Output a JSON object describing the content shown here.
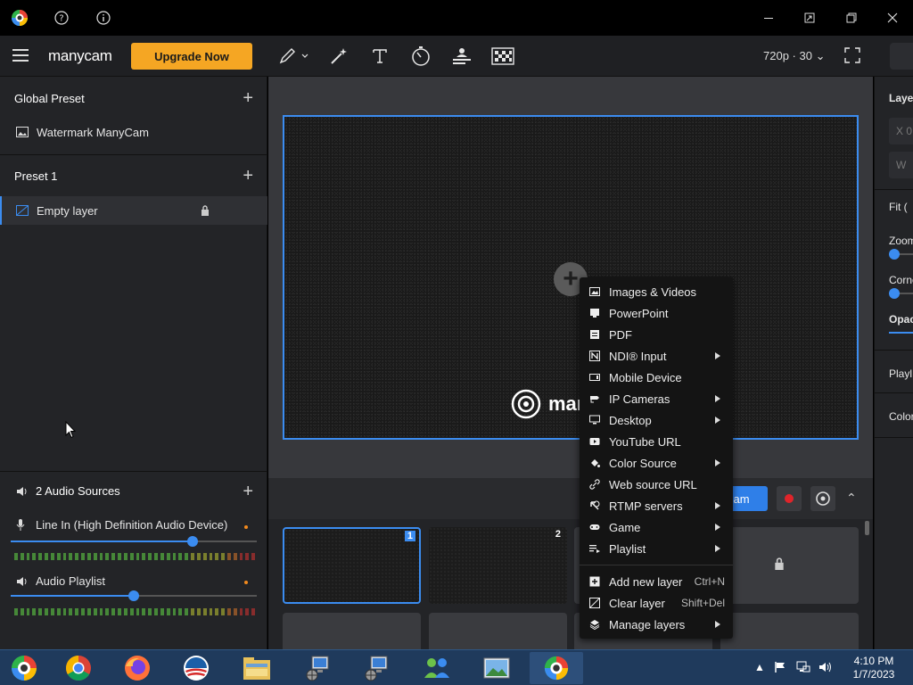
{
  "titlebar": {
    "icons": [
      "manycam-logo-icon",
      "help-icon",
      "info-icon"
    ],
    "window_controls": [
      "minimize-icon",
      "pip-icon",
      "restore-icon",
      "close-icon"
    ]
  },
  "toolbar": {
    "brand": "manycam",
    "upgrade_label": "Upgrade Now",
    "resolution": "720p · 30",
    "tools": [
      "draw-icon",
      "magic-wand-icon",
      "text-icon",
      "timer-icon",
      "lower-third-icon",
      "chroma-key-icon"
    ]
  },
  "left": {
    "global_preset": "Global Preset",
    "global_items": [
      {
        "label": "Watermark ManyCam"
      }
    ],
    "preset1": "Preset 1",
    "preset1_items": [
      {
        "label": "Empty layer"
      }
    ],
    "audio": {
      "title": "2 Audio Sources",
      "sources": [
        {
          "label": "Line In (High Definition Audio Device)",
          "volume": 0.74
        },
        {
          "label": "Audio Playlist",
          "volume": 0.5
        }
      ]
    }
  },
  "stage": {
    "watermark_text": "man",
    "stream_label": "ream"
  },
  "thumbnails": [
    {
      "num": "1",
      "type": "noise",
      "active": true
    },
    {
      "num": "2",
      "type": "noise",
      "active": false
    },
    {
      "num": "",
      "type": "blank",
      "active": false
    },
    {
      "num": "",
      "type": "locked",
      "active": false
    },
    {
      "num": "",
      "zero": "0"
    },
    {
      "num": "",
      "zero": "0"
    },
    {
      "num": "",
      "zero": "0"
    },
    {
      "num": "",
      "zero": "0"
    }
  ],
  "right": {
    "layer": "Layer",
    "x_label": "X",
    "x_value": "0",
    "w_label": "W",
    "fit": "Fit (",
    "zoom": "Zoom",
    "corner": "Corne",
    "opacity": "Opaci",
    "playlist": "Playl",
    "color": "Color"
  },
  "context_menu": {
    "items": [
      {
        "label": "Images & Videos",
        "icon": "image-icon",
        "submenu": false
      },
      {
        "label": "PowerPoint",
        "icon": "powerpoint-icon",
        "submenu": false
      },
      {
        "label": "PDF",
        "icon": "pdf-icon",
        "submenu": false
      },
      {
        "label": "NDI® Input",
        "icon": "ndi-icon",
        "submenu": true
      },
      {
        "label": "Mobile Device",
        "icon": "mobile-device-icon",
        "submenu": false
      },
      {
        "label": "IP Cameras",
        "icon": "ip-camera-icon",
        "submenu": true
      },
      {
        "label": "Desktop",
        "icon": "desktop-icon",
        "submenu": true
      },
      {
        "label": "YouTube URL",
        "icon": "youtube-icon",
        "submenu": false
      },
      {
        "label": "Color Source",
        "icon": "color-bucket-icon",
        "submenu": true
      },
      {
        "label": "Web source URL",
        "icon": "link-icon",
        "submenu": false
      },
      {
        "label": "RTMP servers",
        "icon": "rtmp-icon",
        "submenu": true
      },
      {
        "label": "Game",
        "icon": "gamepad-icon",
        "submenu": true
      },
      {
        "label": "Playlist",
        "icon": "playlist-icon",
        "submenu": true
      }
    ],
    "actions": [
      {
        "label": "Add new layer",
        "icon": "add-layer-icon",
        "shortcut": "Ctrl+N"
      },
      {
        "label": "Clear layer",
        "icon": "clear-layer-icon",
        "shortcut": "Shift+Del"
      },
      {
        "label": "Manage layers",
        "icon": "layers-icon",
        "submenu": true
      }
    ]
  },
  "taskbar": {
    "apps": [
      "manycam-app-icon",
      "chrome-icon",
      "firefox-icon",
      "obama-logo-icon",
      "file-explorer-icon",
      "network-computer-icon",
      "network-computer-icon",
      "people-icon",
      "photo-viewer-icon",
      "manycam-taskbar-icon"
    ],
    "time": "4:10 PM",
    "date": "1/7/2023"
  },
  "colors": {
    "accent": "#3b8cf0",
    "upgrade": "#f5a623",
    "record": "#e0242a"
  }
}
